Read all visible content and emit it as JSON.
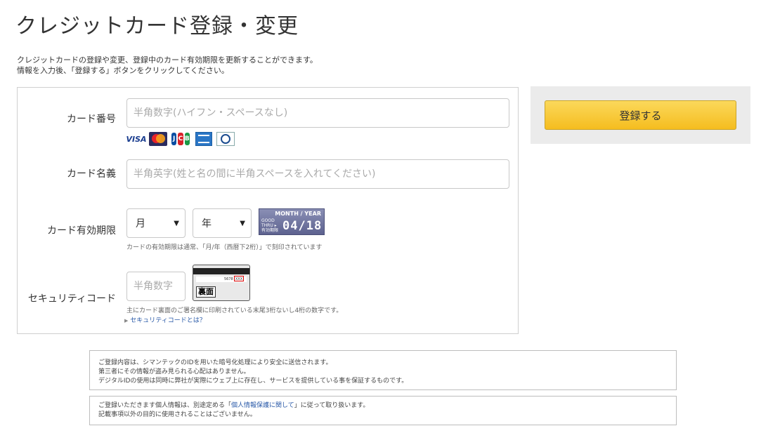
{
  "page": {
    "title": "クレジットカード登録・変更",
    "intro_line1": "クレジットカードの登録や変更、登録中のカード有効期限を更新することができます。",
    "intro_line2": "情報を入力後、「登録する」ボタンをクリックしてください。"
  },
  "form": {
    "card_number": {
      "label": "カード番号",
      "placeholder": "半角数字(ハイフン・スペースなし)",
      "brands": [
        "VISA",
        "MasterCard",
        "JCB",
        "AMERICAN EXPRESS",
        "Diners Club"
      ]
    },
    "card_name": {
      "label": "カード名義",
      "placeholder": "半角英字(姓と名の間に半角スペースを入れてください)"
    },
    "expiry": {
      "label": "カード有効期限",
      "month": "月",
      "year": "年",
      "image_label": "MONTH / YEAR",
      "image_good_thru": "GOOD THRU ▸ 有効期限",
      "image_date": "04/18",
      "note": "カードの有効期限は通常、「月/年（西暦下2桁）」で刻印されています"
    },
    "security": {
      "label": "セキュリティコード",
      "placeholder": "半角数字",
      "image_back_label": "裏面",
      "image_number": "5678",
      "image_cvv": "XXX",
      "note": "主にカード裏面のご署名欄に印刷されている末尾3桁ないし4桁の数字です。",
      "help_link": "セキュリティコードとは？"
    }
  },
  "actions": {
    "register_label": "登録する"
  },
  "info": {
    "security_line1": "ご登録内容は、シマンテックのIDを用いた暗号化処理により安全に送信されます。",
    "security_line2": "第三者にその情報が盗み見られる心配はありません。",
    "security_line3": "デジタルIDの使用は同時に弊社が実際にウェブ上に存在し、サービスを提供している事を保証するものです。",
    "privacy_pre": "ご登録いただきます個人情報は、別途定める「",
    "privacy_link": "個人情報保護に関して",
    "privacy_post": "」に従って取り扱います。",
    "privacy_line2": "記載事項以外の目的に使用されることはございません。"
  },
  "colors": {
    "button_top": "#fbd85b",
    "button_bottom": "#f5bd1f",
    "link": "#2a5aa8",
    "panel_bg": "#ebebeb"
  }
}
